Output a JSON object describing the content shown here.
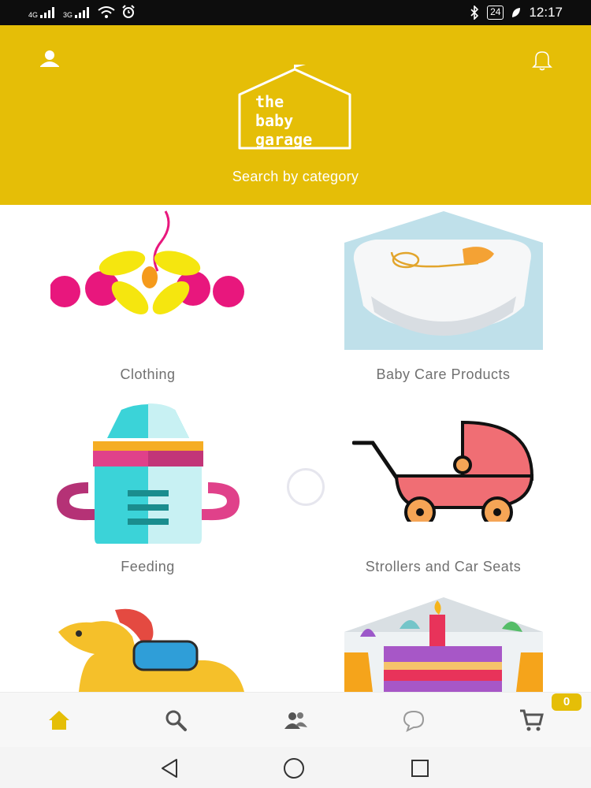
{
  "status_bar": {
    "net1": "4G",
    "net2": "3G",
    "battery": "24",
    "time": "12:17"
  },
  "header": {
    "logo_line1": "the",
    "logo_line2": "baby",
    "logo_line3": "garage",
    "search_category": "Search by category",
    "accent_color": "#e5be07"
  },
  "categories": [
    {
      "label": "Clothing",
      "icon": "clothing-icon"
    },
    {
      "label": "Baby Care Products",
      "icon": "diaper-icon"
    },
    {
      "label": "Feeding",
      "icon": "baby-bottle-icon"
    },
    {
      "label": "Strollers and Car Seats",
      "icon": "stroller-icon"
    },
    {
      "label": "",
      "icon": "rocking-horse-icon"
    },
    {
      "label": "",
      "icon": "birthday-cake-icon"
    }
  ],
  "tabbar": {
    "tabs": [
      "home-icon",
      "search-icon",
      "users-icon",
      "chat-icon",
      "cart-icon"
    ],
    "active": "home",
    "cart_count": "0"
  },
  "navbar": {
    "buttons": [
      "back-icon",
      "home-circle-icon",
      "recents-icon"
    ]
  }
}
